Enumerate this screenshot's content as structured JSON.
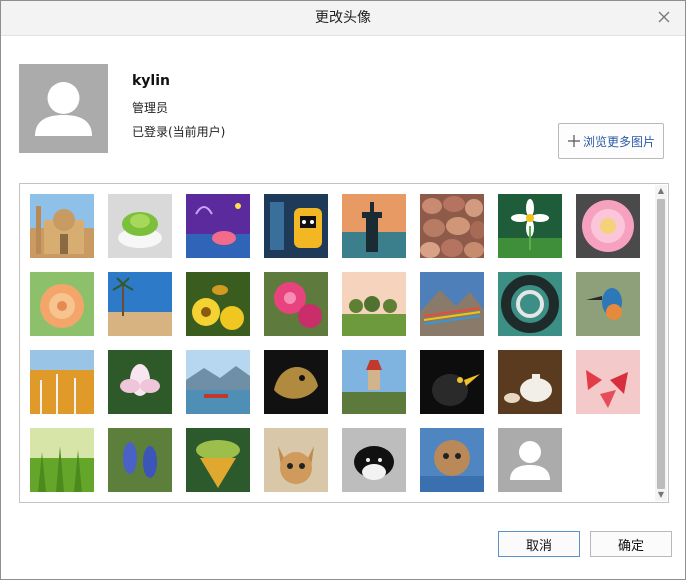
{
  "dialog": {
    "title": "更改头像",
    "close_icon": "close-icon"
  },
  "user": {
    "name": "kylin",
    "role": "管理员",
    "status": "已登录(当前用户)"
  },
  "browse_button": {
    "label": "浏览更多图片",
    "icon": "plus-icon"
  },
  "gallery": {
    "items": [
      {
        "name": "mosque"
      },
      {
        "name": "succulent"
      },
      {
        "name": "cartoon-fish"
      },
      {
        "name": "robot"
      },
      {
        "name": "lighthouse"
      },
      {
        "name": "pebbles"
      },
      {
        "name": "daisy"
      },
      {
        "name": "pink-dahlia"
      },
      {
        "name": "orange-rose"
      },
      {
        "name": "beach-palm"
      },
      {
        "name": "bee-flowers"
      },
      {
        "name": "pink-roses"
      },
      {
        "name": "sunset-trees"
      },
      {
        "name": "mountain-flags"
      },
      {
        "name": "spiral-stairs"
      },
      {
        "name": "kingfisher"
      },
      {
        "name": "autumn-forest"
      },
      {
        "name": "lotus"
      },
      {
        "name": "lake-boat"
      },
      {
        "name": "dragon-carving"
      },
      {
        "name": "pagoda-hill"
      },
      {
        "name": "black-bird"
      },
      {
        "name": "teapot"
      },
      {
        "name": "red-flowers"
      },
      {
        "name": "grass"
      },
      {
        "name": "grape-hyacinth"
      },
      {
        "name": "lotus-pod"
      },
      {
        "name": "kitten"
      },
      {
        "name": "black-white-cat"
      },
      {
        "name": "kitten-blanket"
      },
      {
        "name": "default-avatar"
      }
    ]
  },
  "buttons": {
    "cancel": "取消",
    "ok": "确定"
  },
  "colors": {
    "accent": "#5a93c9",
    "link_text": "#2b5aa8",
    "avatar_bg": "#ababab"
  }
}
